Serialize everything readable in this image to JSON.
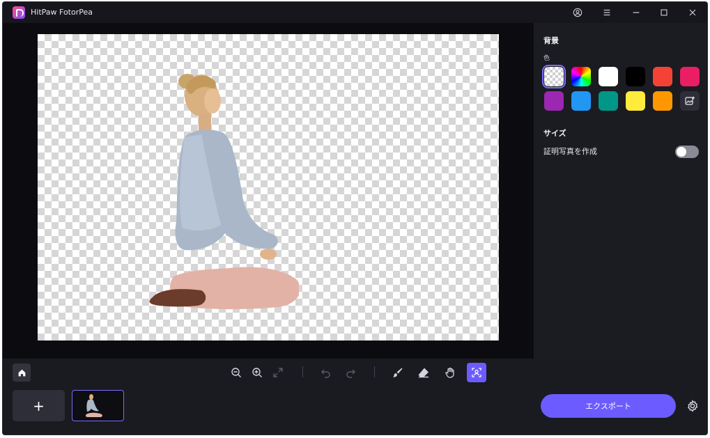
{
  "app": {
    "title": "HitPaw FotorPea"
  },
  "panel": {
    "background_title": "背景",
    "color_label": "色",
    "size_title": "サイズ",
    "id_photo_label": "証明写真を作成",
    "id_photo_enabled": false,
    "swatches": [
      {
        "name": "transparent",
        "color": "transparent",
        "selected": true
      },
      {
        "name": "rainbow",
        "color": "gradient",
        "selected": false
      },
      {
        "name": "white",
        "color": "#ffffff",
        "selected": false
      },
      {
        "name": "black",
        "color": "#000000",
        "selected": false
      },
      {
        "name": "red",
        "color": "#f44336",
        "selected": false
      },
      {
        "name": "pink",
        "color": "#e91e63",
        "selected": false
      },
      {
        "name": "purple",
        "color": "#9c27b0",
        "selected": false
      },
      {
        "name": "blue",
        "color": "#2196f3",
        "selected": false
      },
      {
        "name": "teal",
        "color": "#009688",
        "selected": false
      },
      {
        "name": "yellow",
        "color": "#ffeb3b",
        "selected": false
      },
      {
        "name": "orange",
        "color": "#ff9800",
        "selected": false
      },
      {
        "name": "custom-image",
        "color": "#2e2e38",
        "selected": false
      }
    ]
  },
  "toolbar": {
    "export_label": "エクスポート",
    "add_label": "+"
  },
  "colors": {
    "accent": "#6c5cff",
    "panel_bg": "#1b1b22",
    "app_bg": "#0f0f14"
  }
}
